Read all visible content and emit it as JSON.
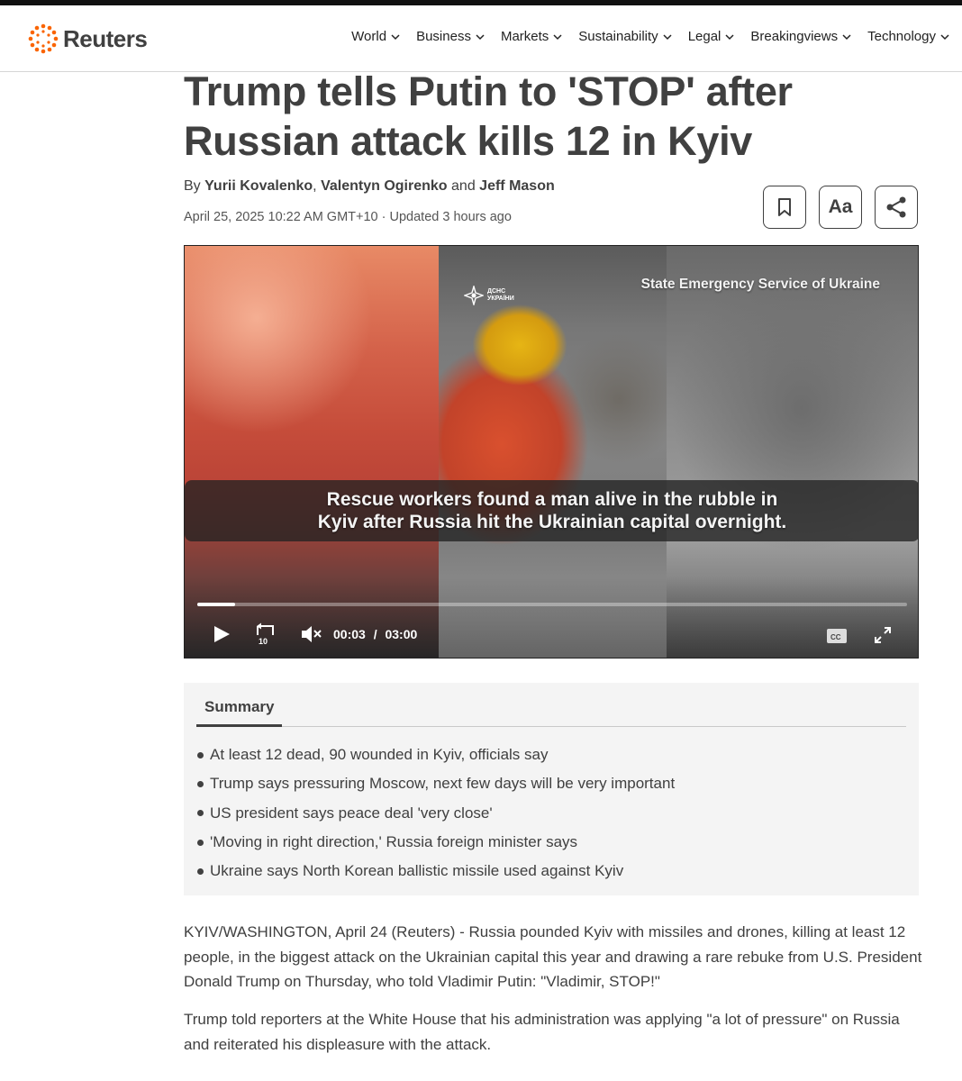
{
  "brand": {
    "name": "Reuters",
    "accent": "#fa6400"
  },
  "nav": {
    "items": [
      {
        "label": "World"
      },
      {
        "label": "Business"
      },
      {
        "label": "Markets"
      },
      {
        "label": "Sustainability"
      },
      {
        "label": "Legal"
      },
      {
        "label": "Breakingviews"
      },
      {
        "label": "Technology"
      }
    ]
  },
  "article": {
    "headline": "Trump tells Putin to 'STOP' after Russian attack kills 12 in Kyiv",
    "byline": {
      "prefix": "By",
      "authors": [
        "Yurii Kovalenko",
        "Valentyn Ogirenko",
        "Jeff Mason"
      ],
      "sep1": ",",
      "sep2": "and"
    },
    "dateline": "April 25, 2025 10:22 AM GMT+10 · Updated 3 hours ago",
    "tools": {
      "text_size_label": "Aa"
    },
    "video": {
      "emblem_text": "ДСНС УКРАЇНИ",
      "source_credit": "State Emergency Service of Ukraine",
      "caption_line1": "Rescue workers found a man alive in the rubble in",
      "caption_line2": "Kyiv after Russia hit the Ukrainian capital overnight.",
      "current_time": "00:03",
      "time_separator": "/",
      "duration": "03:00",
      "progress_fraction": 0.053,
      "rewind_seconds": "10",
      "cc_label": "CC"
    },
    "summary": {
      "tab_label": "Summary",
      "items": [
        "At least 12 dead, 90 wounded in Kyiv, officials say",
        "Trump says pressuring Moscow, next few days will be very important",
        "US president says peace deal 'very close'",
        "'Moving in right direction,' Russia foreign minister says",
        "Ukraine says North Korean ballistic missile used against Kyiv"
      ]
    },
    "body": [
      "KYIV/WASHINGTON, April 24 (Reuters) - Russia pounded Kyiv with missiles and drones, killing at least 12 people, in the biggest attack on the Ukrainian capital this year and drawing a rare rebuke from U.S. President Donald Trump on Thursday, who told Vladimir Putin: \"Vladimir, STOP!\"",
      "Trump told reporters at the White House that his administration was applying \"a lot of pressure\" on Russia and reiterated his displeasure with the attack."
    ]
  }
}
